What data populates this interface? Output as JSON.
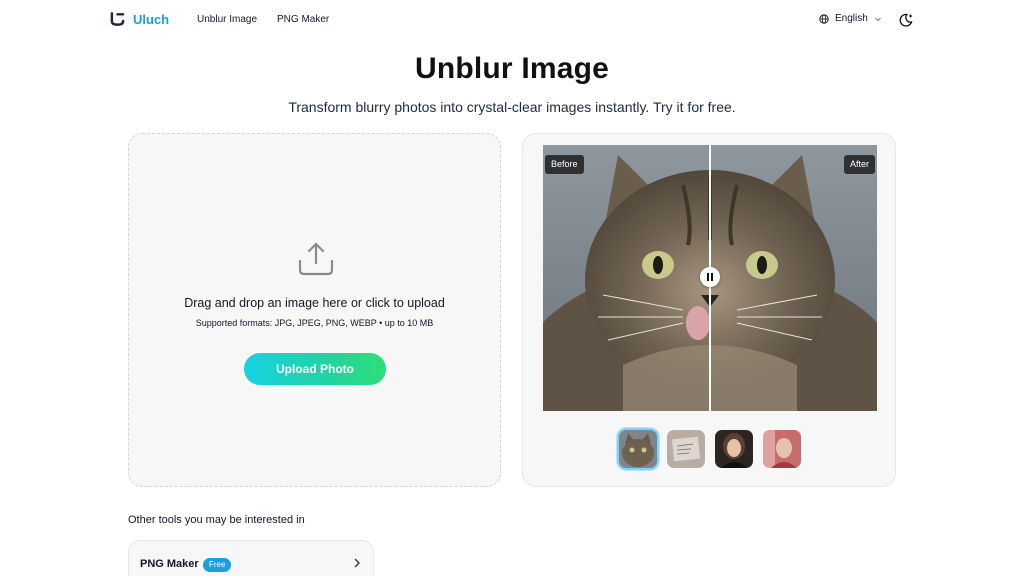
{
  "header": {
    "brand": "Uluch",
    "nav": [
      {
        "label": "Unblur Image"
      },
      {
        "label": "PNG Maker"
      }
    ],
    "language": "English"
  },
  "hero": {
    "title": "Unblur Image",
    "subtitle": "Transform blurry photos into crystal-clear images instantly. Try it for free."
  },
  "upload": {
    "prompt": "Drag and drop an image here or click to upload",
    "formats": "Supported formats: JPG, JPEG, PNG, WEBP • up to 10 MB",
    "button": "Upload Photo"
  },
  "compare": {
    "before_label": "Before",
    "after_label": "After",
    "thumbnails": [
      {
        "name": "cat",
        "active": true
      },
      {
        "name": "note"
      },
      {
        "name": "woman-portrait"
      },
      {
        "name": "girl-portrait"
      }
    ]
  },
  "other_tools": {
    "heading": "Other tools you may be interested in",
    "items": [
      {
        "name": "PNG Maker",
        "badge": "Free"
      }
    ]
  },
  "colors": {
    "brand": "#1a9fe0",
    "button_gradient_start": "#14d3e4",
    "button_gradient_end": "#2dde78"
  },
  "icons": [
    "logo-icon",
    "globe-icon",
    "chevron-down-icon",
    "theme-toggle-icon",
    "upload-icon",
    "pause-icon",
    "chevron-right-icon"
  ]
}
